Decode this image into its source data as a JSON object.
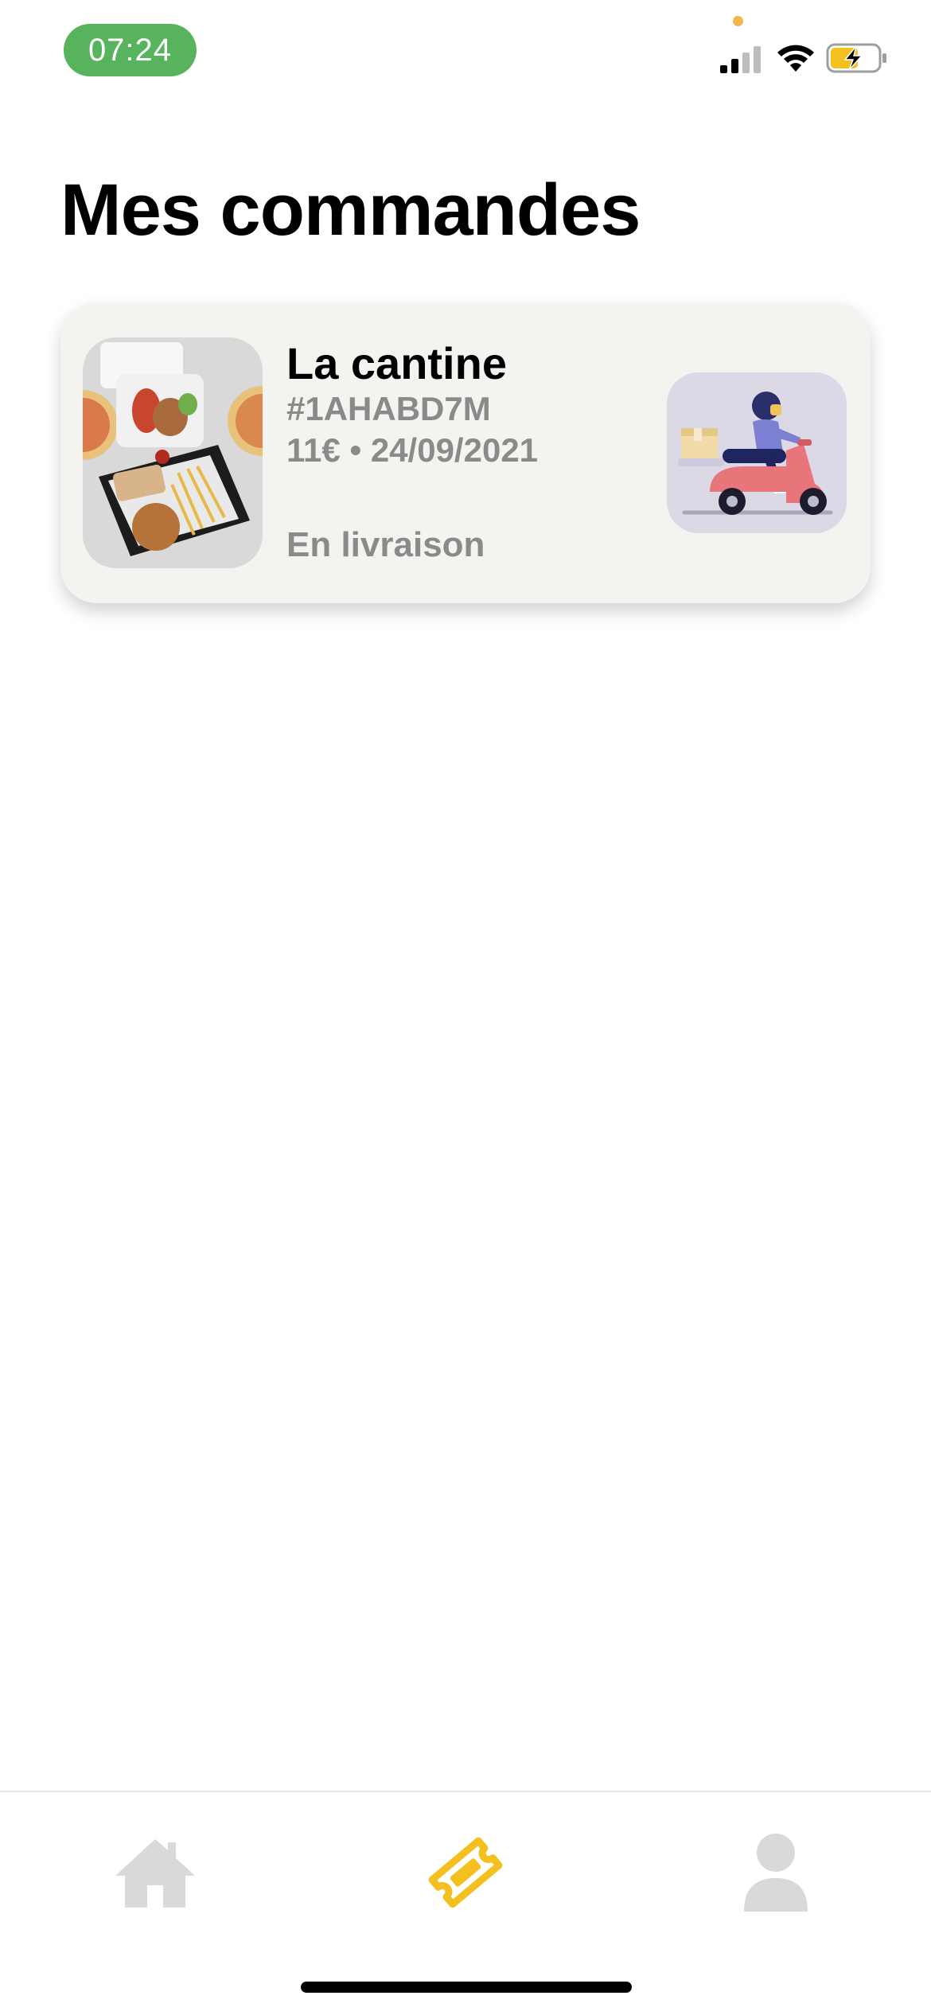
{
  "status_bar": {
    "time": "07:24",
    "time_pill_color": "#57b35c",
    "icons": [
      "signal-icon",
      "wifi-icon",
      "battery-charging-icon"
    ]
  },
  "page": {
    "title": "Mes commandes"
  },
  "orders": [
    {
      "restaurant": "La cantine",
      "order_id": "#1AHABD7M",
      "amount": "11€",
      "separator": "•",
      "date": "24/09/2021",
      "status": "En livraison",
      "status_illustration": "delivery-scooter-illustration"
    }
  ],
  "tab_bar": {
    "tabs": [
      {
        "id": "home",
        "icon": "home-icon",
        "active": false
      },
      {
        "id": "orders",
        "icon": "ticket-icon",
        "active": true
      },
      {
        "id": "profile",
        "icon": "profile-icon",
        "active": false
      }
    ],
    "active_color": "#f4c020",
    "inactive_color": "#d9d9d9"
  }
}
